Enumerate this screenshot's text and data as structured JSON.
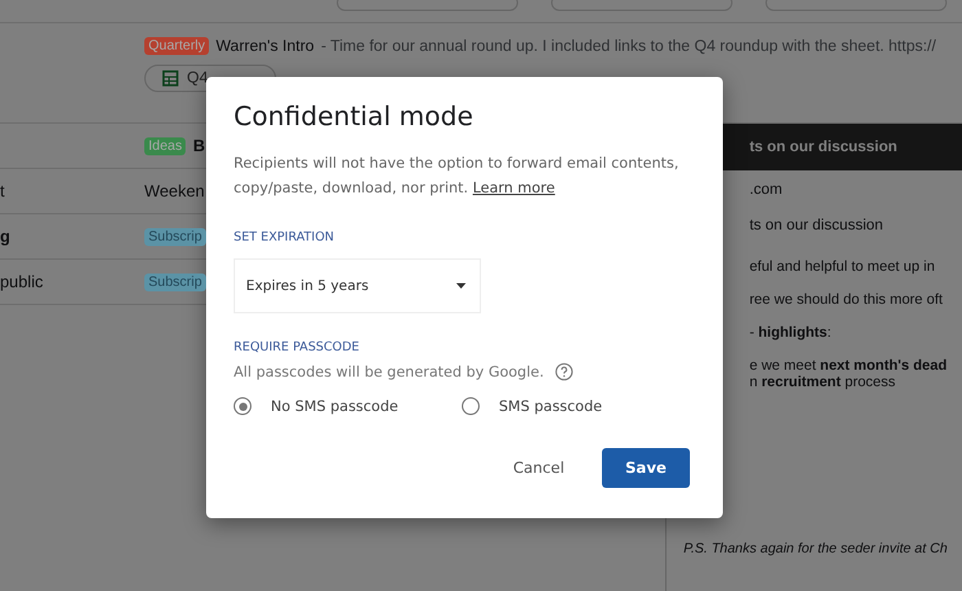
{
  "top_row": {
    "tag": {
      "label": "Quarterly",
      "color": "#b5402f"
    },
    "subject": "Warren's Intro",
    "snippet": " - Time for our annual round up. I included links to the Q4 roundup with the sheet. https://",
    "attachment": "Q4"
  },
  "rows": [
    {
      "sender": "",
      "tag": {
        "label": "Ideas",
        "color": "#3a8a4c"
      },
      "subject": "B",
      "bold": true
    },
    {
      "sender": "t",
      "subject": "Weeken",
      "bold": false
    },
    {
      "sender": "g",
      "tag": {
        "label": "Subscrip",
        "color": "#5b93a6"
      },
      "bold": true
    },
    {
      "sender": "public",
      "tag": {
        "label": "Subscrip",
        "color": "#5b93a6"
      },
      "bold": false
    }
  ],
  "preview": {
    "header": "ts on our discussion",
    "from": ".com",
    "subject": "ts on our discussion",
    "paragraphs": [
      {
        "text": "eful and helpful to meet up in",
        "kind": "plain"
      },
      {
        "text": "ree we should do this more oft",
        "kind": "plain"
      },
      {
        "text": "- **highlights**:",
        "kind": "plain"
      },
      {
        "text": "e we meet **next month's dead**",
        "kind": "plain"
      },
      {
        "text": "n **recruitment** process",
        "kind": "tight"
      },
      {
        "text": "P.S. Thanks again for the seder invite at Ch",
        "kind": "italic"
      }
    ]
  },
  "dialog": {
    "title": "Confidential mode",
    "description": "Recipients will not have the option to forward email contents, copy/paste, download, nor print.",
    "learn_more": "Learn more",
    "expiration_label": "SET EXPIRATION",
    "expiration_value": "Expires in 5 years",
    "passcode_label": "REQUIRE PASSCODE",
    "passcode_note": "All passcodes will be generated by Google.",
    "passcode_options": [
      {
        "label": "No SMS passcode",
        "selected": true
      },
      {
        "label": "SMS passcode",
        "selected": false
      }
    ],
    "buttons": [
      {
        "label": "Cancel",
        "kind": "text"
      },
      {
        "label": "Save",
        "kind": "primary"
      }
    ]
  }
}
